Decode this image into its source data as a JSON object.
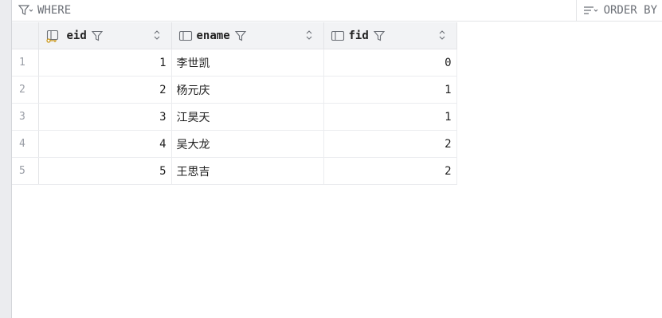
{
  "filter": {
    "where_label": "WHERE",
    "order_by_label": "ORDER BY"
  },
  "columns": [
    {
      "name": "eid",
      "icon": "primary-key-column-icon"
    },
    {
      "name": "ename",
      "icon": "column-icon"
    },
    {
      "name": "fid",
      "icon": "column-icon"
    }
  ],
  "rows": [
    {
      "num": "1",
      "eid": "1",
      "ename": "李世凯",
      "fid": "0"
    },
    {
      "num": "2",
      "eid": "2",
      "ename": "杨元庆",
      "fid": "1"
    },
    {
      "num": "3",
      "eid": "3",
      "ename": "江昊天",
      "fid": "1"
    },
    {
      "num": "4",
      "eid": "4",
      "ename": "吴大龙",
      "fid": "2"
    },
    {
      "num": "5",
      "eid": "5",
      "ename": "王思吉",
      "fid": "2"
    }
  ]
}
